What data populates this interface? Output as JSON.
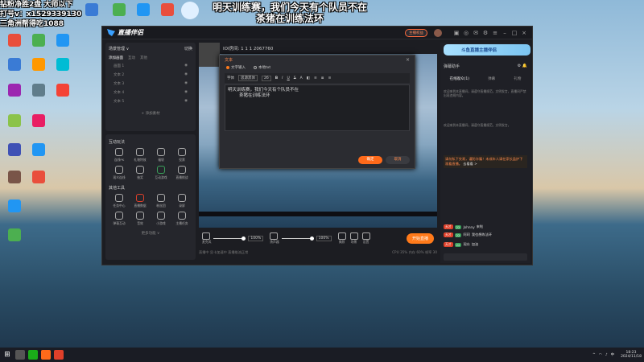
{
  "overlay": {
    "left_lines": [
      "钻粉净胜2盘 大师以下",
      "打号v：x1529339130",
      "三角洲帮得吃1088"
    ],
    "top_lines": [
      "明天训练赛，我们今天有个队员不在",
      "茶猪在训练法环"
    ]
  },
  "desktop_icons": [
    {
      "label": "",
      "color": "#3a7bd5"
    },
    {
      "label": "",
      "color": "#e94e3c"
    },
    {
      "label": "",
      "color": "#4caf50"
    },
    {
      "label": "",
      "color": "#2196f3"
    },
    {
      "label": "",
      "color": "#ff9800"
    },
    {
      "label": "",
      "color": "#9c27b0"
    },
    {
      "label": "",
      "color": "#00bcd4"
    },
    {
      "label": "",
      "color": "#f44336"
    },
    {
      "label": "",
      "color": "#ffeb3b"
    },
    {
      "label": "",
      "color": "#795548"
    },
    {
      "label": "",
      "color": "#607d8b"
    },
    {
      "label": "",
      "color": "#8bc34a"
    },
    {
      "label": "",
      "color": "#3f51b5"
    },
    {
      "label": "",
      "color": "#e91e63"
    }
  ],
  "top_icons": [
    {
      "label": "",
      "color": "#3a7bd5"
    },
    {
      "label": "",
      "color": "#4caf50"
    },
    {
      "label": "",
      "color": "#ff5722"
    },
    {
      "label": "",
      "color": "#2196f3"
    },
    {
      "label": "",
      "color": "#e94e3c"
    }
  ],
  "app": {
    "title": "直播伴侣",
    "version": "",
    "record_label": "主播权益",
    "scene": {
      "header": "场景管理 ∨",
      "header_right": "切换",
      "tabs": [
        "添加画面",
        "互动",
        "其他"
      ],
      "sources": [
        "画面 1",
        "文本 2",
        "文本 3",
        "文本 4",
        "文本 5"
      ],
      "add_source": "+ 添加素材"
    },
    "tools": {
      "title1": "互动玩法",
      "row1": [
        "连线PK",
        "礼物特效",
        "福袋",
        "投票"
      ],
      "row2": [
        "观众连线",
        "抽奖",
        "互动游戏",
        "直播挑战"
      ],
      "title2": "其他工具",
      "row3": [
        "任务中心",
        "直播数据",
        "粉丝团",
        "录屏"
      ],
      "row4": [
        "弹幕互动",
        "音效",
        "小游戏",
        "主播任务"
      ],
      "more": "更多功能 ∨"
    },
    "room_label": "IOI房间: 1 1 1 2067760",
    "controls": {
      "mic_label": "麦克风",
      "mic_pct": "100%",
      "spk_label": "扬声器",
      "spk_pct": "100%",
      "beauty_label": "美颜",
      "scene_label": "场景",
      "settings_label": "设置",
      "live_button": "开始直播"
    },
    "status_left": "直播中 显卡加速中 直播推流正常",
    "status_right": "CPU 35%  内存 60%  帧率 30",
    "right": {
      "banner": "斗鱼直播主播伴侣",
      "head_left": "弹幕助手",
      "head_right": "⚙ 🔔",
      "tabs": [
        "在线观众(1)",
        "弹幕",
        "礼物"
      ],
      "msg1": "欢迎来到本直播间，请遵守直播规范，文明发言，直播间严禁出现违规内容。",
      "msg2": "欢迎来到本直播间，请遵守直播规范，文明发言。",
      "notice": "请勿私下交易，谨防诈骗！未成年人请在家长监护下观看直播。",
      "notice_link": "去看看 >",
      "chat": [
        {
          "badge": "天才",
          "level": "22",
          "name": "Johnny",
          "text": "来啦"
        },
        {
          "badge": "天才",
          "level": "22",
          "name": "阿珂",
          "text": "我也想练法环"
        },
        {
          "badge": "天才",
          "level": "22",
          "name": "观众",
          "text": "加油"
        }
      ]
    },
    "dialog": {
      "title": "文本",
      "radios": [
        "文字输入",
        "本地txt"
      ],
      "toolbar": [
        "字体",
        "思源黑体",
        "26",
        "B",
        "I",
        "U",
        "S"
      ],
      "text_line1": "明天训练赛，我们今天有个队员不在",
      "text_line2": "茶猪在训练法环",
      "ok": "确定",
      "cancel": "取消"
    }
  },
  "taskbar": {
    "time": "18:23",
    "date": "2024/11/18"
  }
}
